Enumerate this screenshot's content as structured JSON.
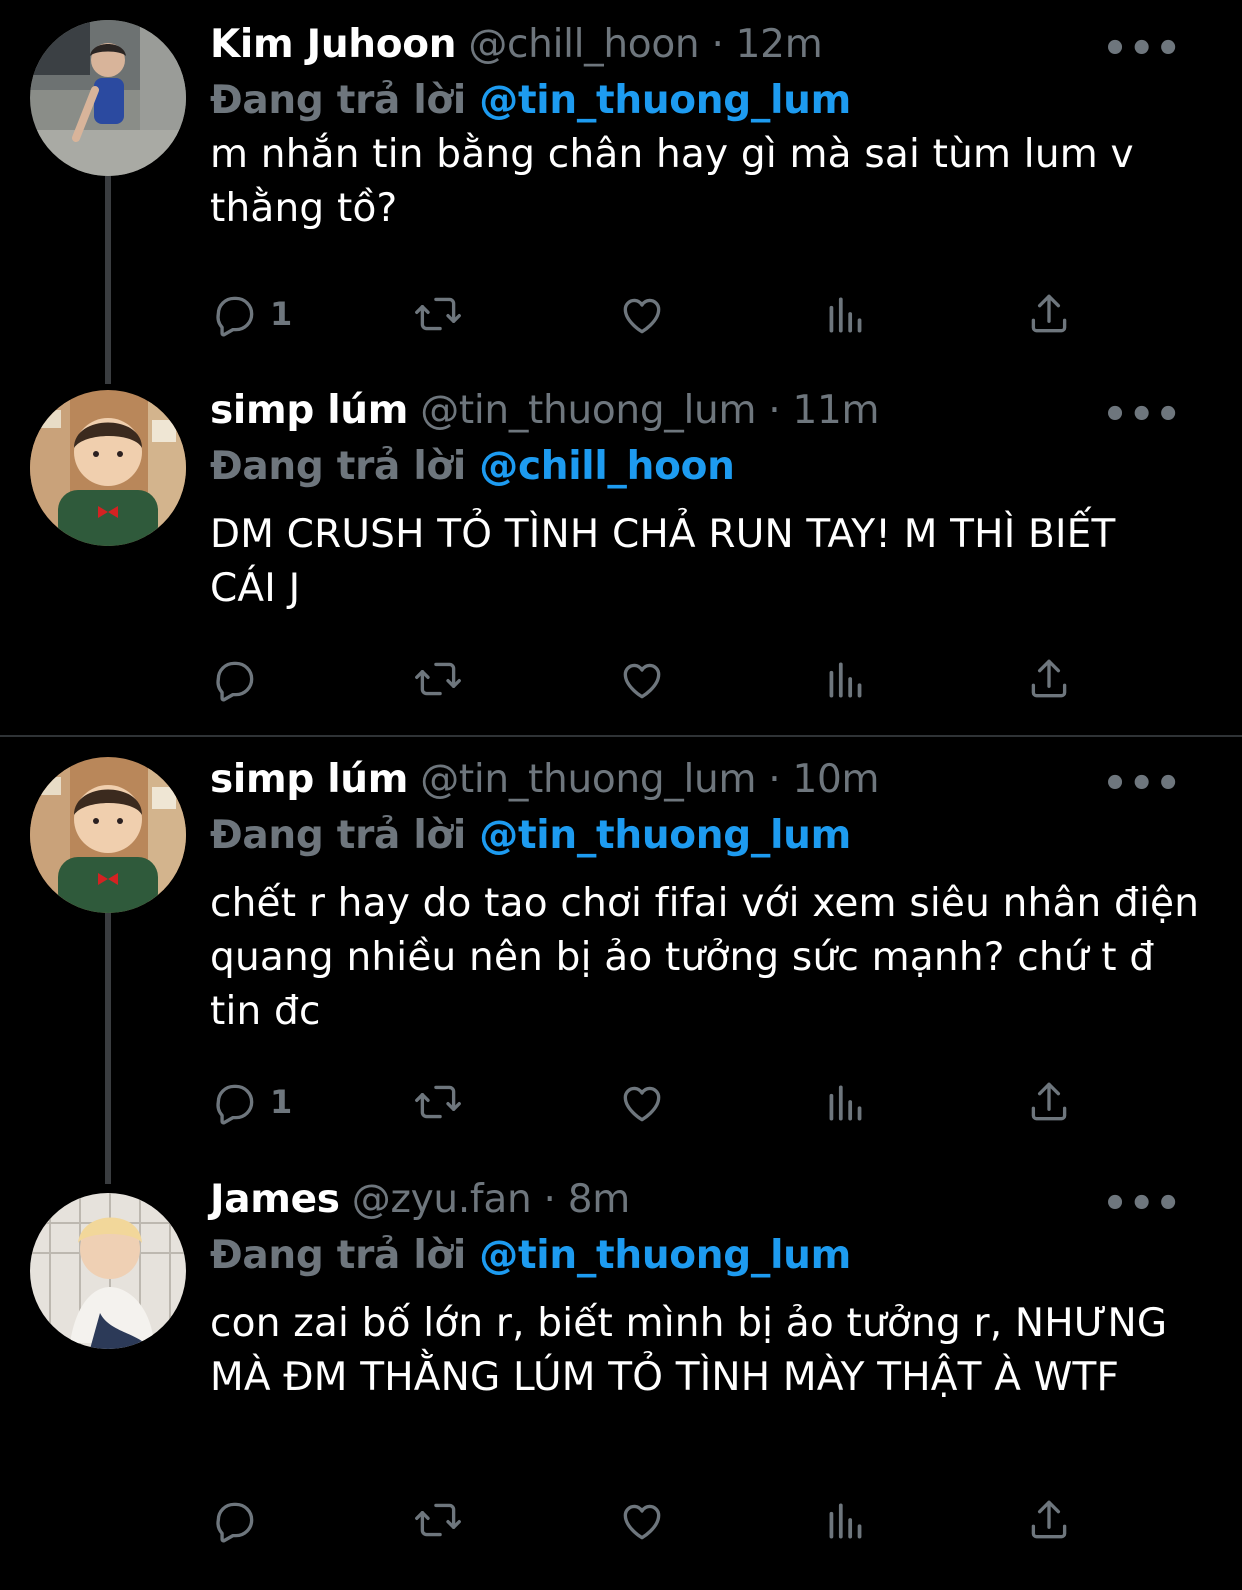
{
  "tweets": [
    {
      "name": "Kim Juhoon",
      "handle": "@chill_hoon",
      "dot": "·",
      "time": "12m",
      "reply_prefix": "Đang trả lời",
      "reply_to": "@tin_thuong_lum",
      "text": "m nhắn tin bằng chân hay gì mà sai tùm lum v thằng tồ?",
      "reply_count": "1",
      "more": "•••"
    },
    {
      "name": "simp lúm",
      "handle": "@tin_thuong_lum",
      "dot": "·",
      "time": "11m",
      "reply_prefix": "Đang trả lời",
      "reply_to": "@chill_hoon",
      "text": "DM CRUSH TỎ TÌNH CHẢ RUN TAY! M THÌ BIẾT CÁI J",
      "reply_count": "",
      "more": "•••"
    },
    {
      "name": "simp lúm",
      "handle": "@tin_thuong_lum",
      "dot": "·",
      "time": "10m",
      "reply_prefix": "Đang trả lời",
      "reply_to": "@tin_thuong_lum",
      "text": "chết r hay do tao chơi fifai với xem siêu nhân điện quang nhiều nên bị ảo tưởng sức mạnh? chứ t đ tin đc",
      "reply_count": "1",
      "more": "•••"
    },
    {
      "name": "James",
      "handle": "@zyu.fan",
      "dot": "·",
      "time": "8m",
      "reply_prefix": "Đang trả lời",
      "reply_to": "@tin_thuong_lum",
      "text": "con zai bố lớn r, biết mình bị ảo tưởng r, NHƯNG MÀ ĐM THẰNG LÚM TỎ TÌNH MÀY THẬT À WTF",
      "reply_count": "",
      "more": "•••"
    }
  ],
  "colors": {
    "background": "#000000",
    "mention": "#1d9bf0",
    "secondary": "#6e767d",
    "thread_line": "#3a3d40"
  },
  "icons": [
    "reply-icon",
    "retweet-icon",
    "like-icon",
    "analytics-icon",
    "share-icon",
    "more-icon"
  ]
}
